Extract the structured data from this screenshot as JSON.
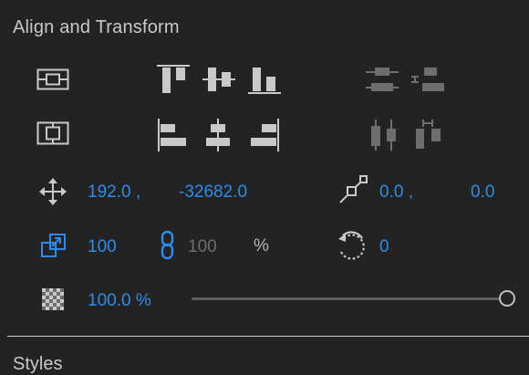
{
  "panel": {
    "title": "Align and Transform"
  },
  "next_section": {
    "title": "Styles"
  },
  "position": {
    "x": "192.0 ,",
    "y": "-32682.0"
  },
  "anchor": {
    "x": "0.0 ,",
    "y": "0.0"
  },
  "scale": {
    "width": "100",
    "height": "100",
    "unit": "%"
  },
  "rotation": {
    "value": "0"
  },
  "opacity": {
    "value": "100.0 %",
    "level": 1.0
  },
  "colors": {
    "accent": "#2d8ceb",
    "icon": "#c9c9c9",
    "icon_disabled": "#6e6e6e",
    "background": "#232323"
  },
  "icons": [
    "align-to-selection-icon",
    "align-top-icon",
    "align-vertical-center-icon",
    "align-bottom-icon",
    "distribute-vertical-center-icon",
    "distribute-vertical-space-icon",
    "align-to-artboard-icon",
    "align-left-icon",
    "align-horizontal-center-icon",
    "align-right-icon",
    "distribute-horizontal-center-icon",
    "distribute-horizontal-space-icon",
    "move-icon",
    "anchor-point-icon",
    "scale-icon",
    "link-icon",
    "rotate-icon",
    "opacity-icon"
  ]
}
